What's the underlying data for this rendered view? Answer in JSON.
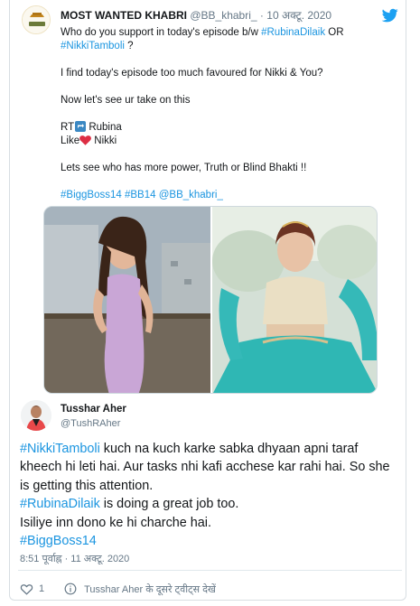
{
  "quoted_tweet": {
    "author_name": "MOST WANTED KHABRI",
    "author_handle": "@BB_khabri_",
    "separator": "·",
    "date": "10 अक्टू. 2020",
    "lines": [
      "Who do you support in today's episode b/w ",
      "#RubinaDilaik",
      " OR",
      "#NikkiTamboli",
      " ?",
      "I find today's episode too much favoured for Nikki & You?",
      "Now let's see ur take on this",
      "RT",
      " Rubina",
      "Like",
      " Nikki",
      "Lets see who has more power, Truth or Blind Bhakti !!",
      "#BiggBoss14",
      "#BB14",
      "@BB_khabri_"
    ]
  },
  "reply": {
    "author_name": "Tusshar Aher",
    "author_handle": "@TushRAher",
    "text": {
      "tag1": "#NikkiTamboli",
      "p1": " kuch na kuch karke sabka dhyaan apni taraf kheech hi leti hai. Aur tasks nhi kafi acchese kar rahi hai. So she is getting this attention.",
      "tag2": "#RubinaDilaik",
      "p2": " is doing a great job too.",
      "p3": "Isiliye inn dono ke hi charche hai.",
      "tag3": "#BiggBoss14"
    },
    "timestamp": "8:51 पूर्वाह्न · 11 अक्टू. 2020",
    "like_count": "1",
    "view_more": "Tusshar Aher के दूसरे ट्वीट्स देखें"
  },
  "colors": {
    "link": "#1b95e0",
    "twitter_blue": "#1da1f2",
    "muted": "#657786",
    "heart": "#e0245e"
  },
  "icons": [
    "twitter-bird-icon",
    "retweet-icon",
    "heart-icon",
    "like-icon",
    "info-icon"
  ]
}
